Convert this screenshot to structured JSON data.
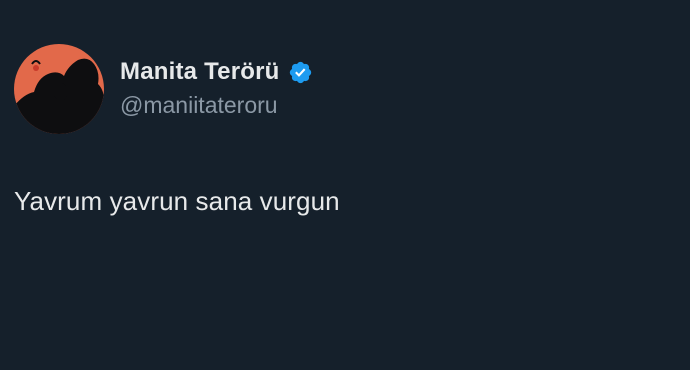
{
  "tweet": {
    "author": {
      "display_name": "Manita Terörü",
      "handle": "@maniitateroru",
      "verified": true,
      "avatar_icon": "silhouette-avatar"
    },
    "text": "Yavrum yavrun sana vurgun"
  },
  "colors": {
    "background": "#15202b",
    "primary_text": "#e7e9ea",
    "secondary_text": "#8b98a5",
    "verified_badge": "#1d9bf0",
    "avatar_bg": "#e2694a"
  }
}
